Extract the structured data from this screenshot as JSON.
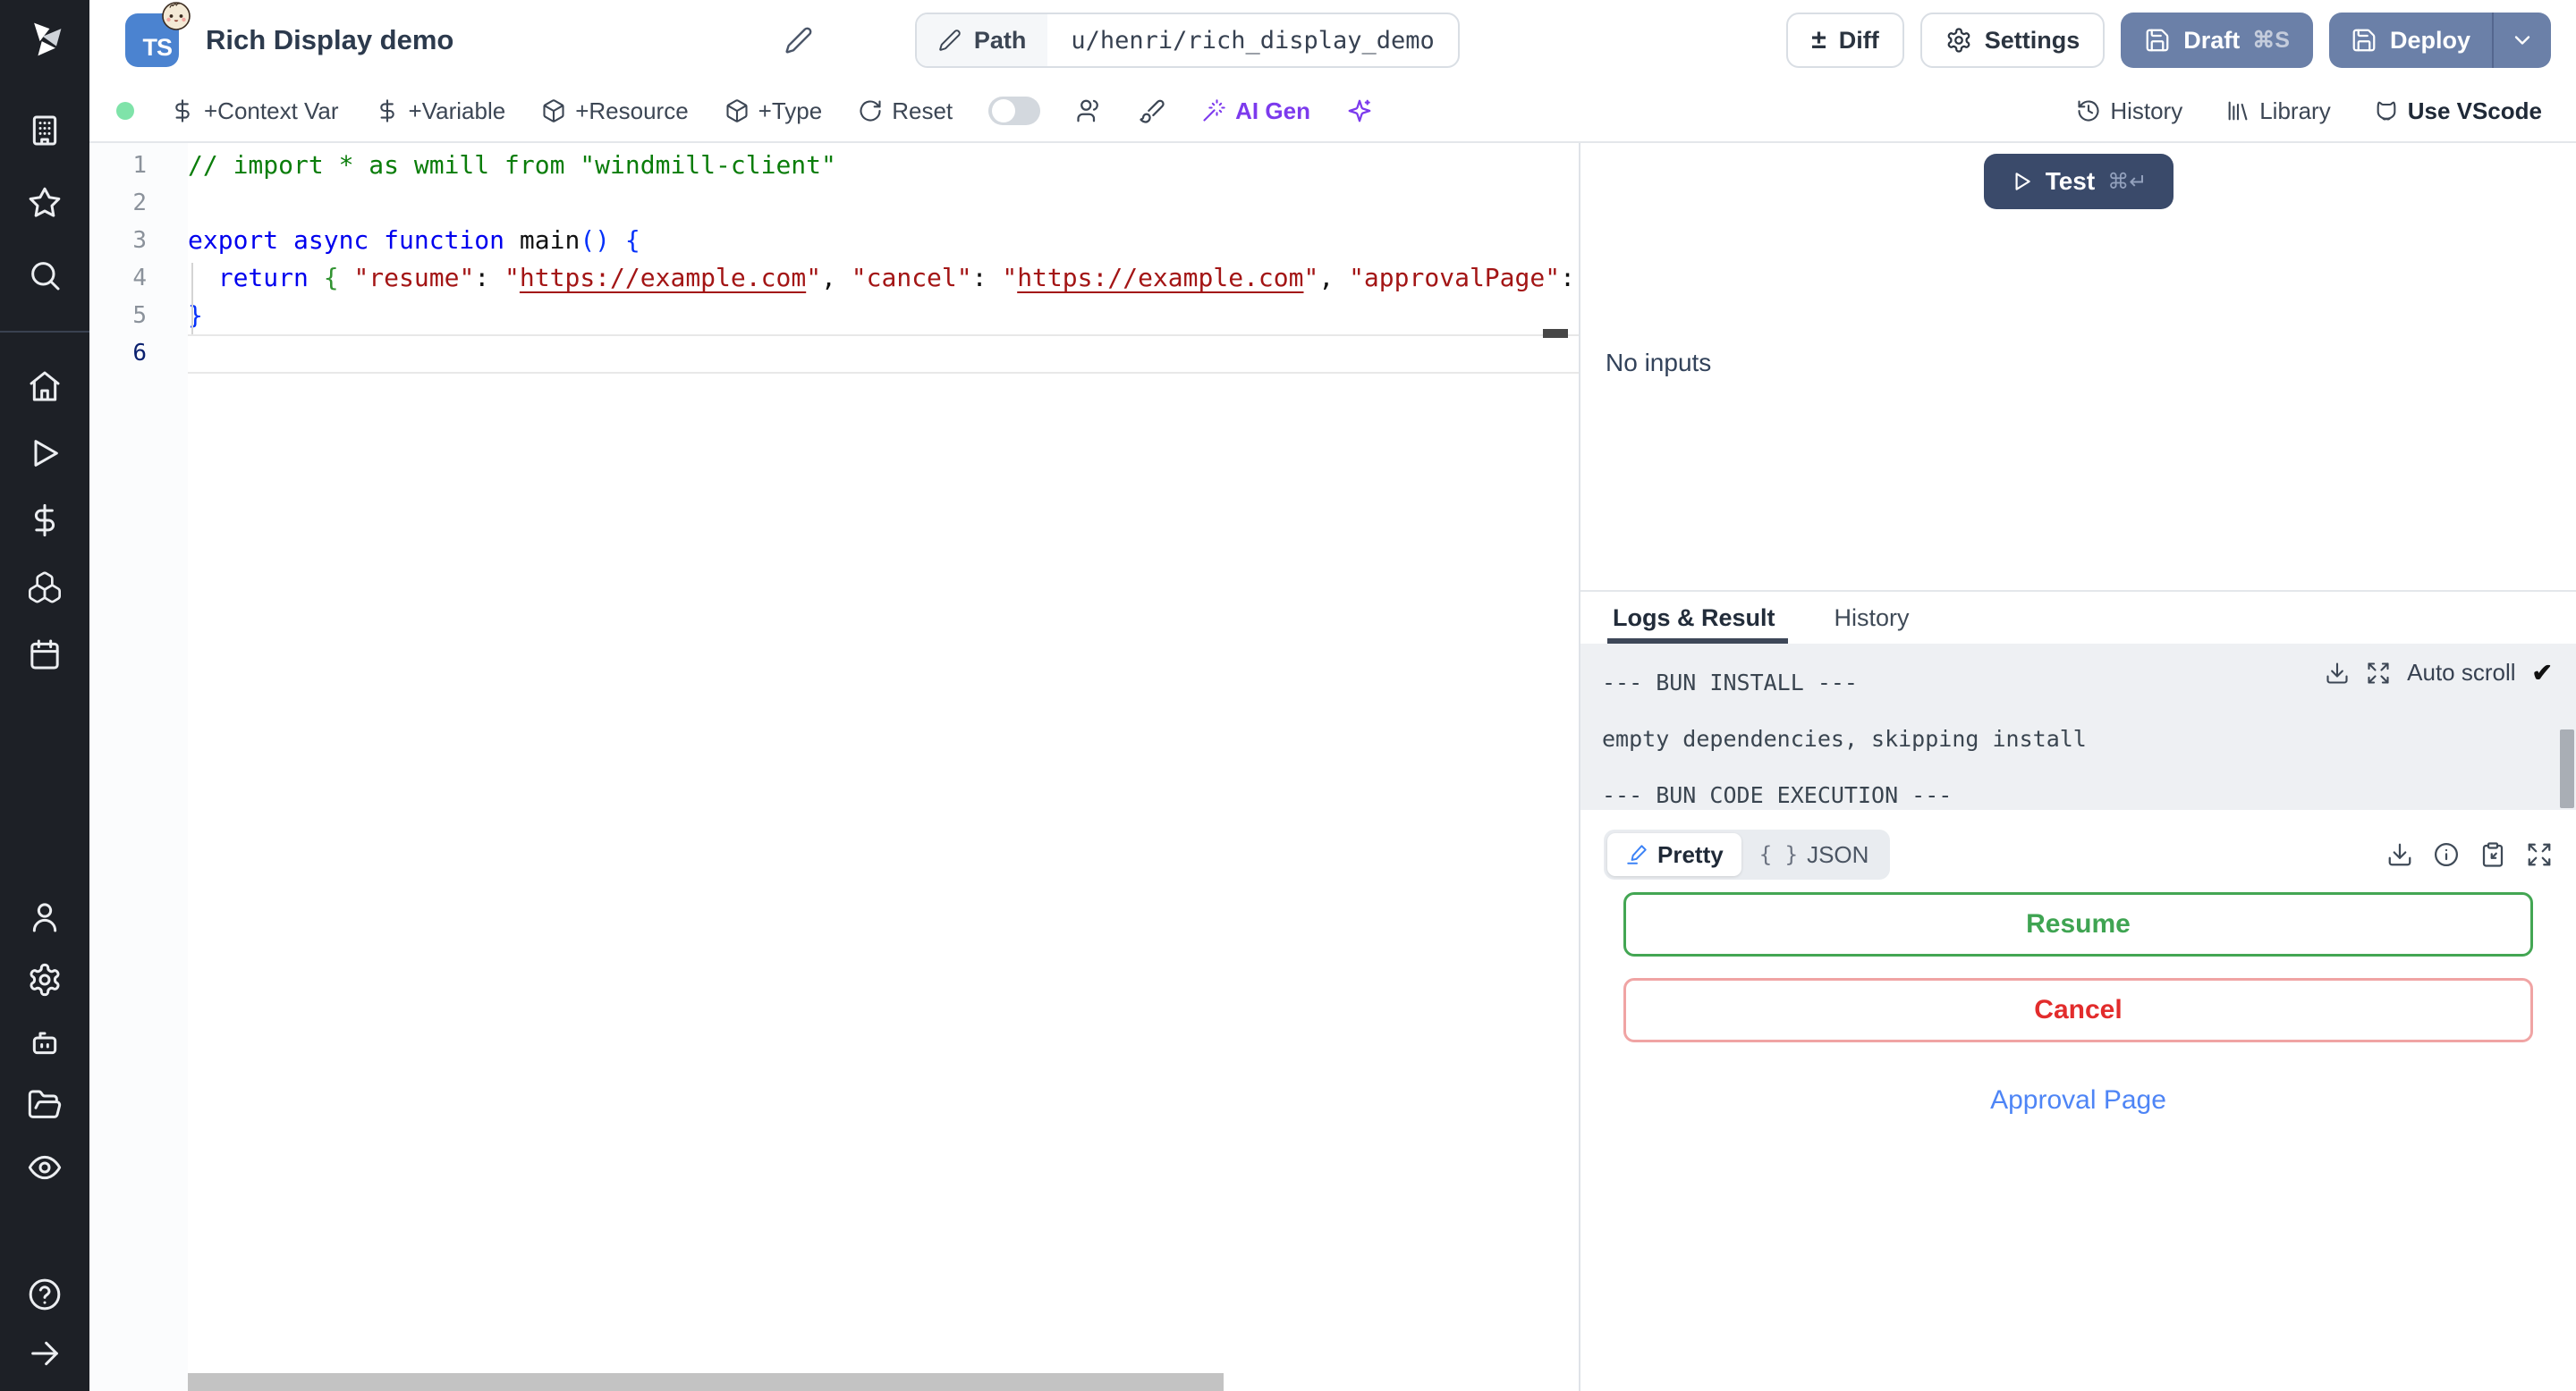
{
  "sidebar": {
    "icons": [
      "windmill-logo",
      "building",
      "star",
      "search",
      "home",
      "play",
      "dollar",
      "boxes",
      "calendar",
      "user",
      "settings",
      "bot",
      "folder-open",
      "eye",
      "help",
      "arrow-right"
    ]
  },
  "header": {
    "title": "Rich Display demo",
    "badge": "TS",
    "path_label": "Path",
    "path_value": "u/henri/rich_display_demo",
    "diff_label": "Diff",
    "settings_label": "Settings",
    "draft_label": "Draft",
    "draft_shortcut": "⌘S",
    "deploy_label": "Deploy"
  },
  "toolbar": {
    "context_var": "+Context Var",
    "variable": "+Variable",
    "resource": "+Resource",
    "type": "+Type",
    "reset": "Reset",
    "ai_gen": "AI Gen",
    "history": "History",
    "library": "Library",
    "vscode": "Use VScode"
  },
  "editor": {
    "line_numbers": [
      "1",
      "2",
      "3",
      "4",
      "5",
      "6"
    ],
    "lines": [
      {
        "tokens": [
          {
            "c": "cm",
            "t": "// import * as wmill from \"windmill-client\""
          }
        ]
      },
      {
        "tokens": []
      },
      {
        "tokens": [
          {
            "c": "kw",
            "t": "export async function "
          },
          {
            "c": "fn",
            "t": "main"
          },
          {
            "c": "brb",
            "t": "() {"
          }
        ]
      },
      {
        "tokens": [
          {
            "c": "pln",
            "t": "  "
          },
          {
            "c": "kw",
            "t": "return "
          },
          {
            "c": "brg",
            "t": "{ "
          },
          {
            "c": "str",
            "t": "\"resume\""
          },
          {
            "c": "pln",
            "t": ": "
          },
          {
            "c": "str",
            "t": "\""
          },
          {
            "c": "lnk",
            "t": "https://example.com"
          },
          {
            "c": "str",
            "t": "\""
          },
          {
            "c": "pln",
            "t": ", "
          },
          {
            "c": "str",
            "t": "\"cancel\""
          },
          {
            "c": "pln",
            "t": ": "
          },
          {
            "c": "str",
            "t": "\""
          },
          {
            "c": "lnk",
            "t": "https://example.com"
          },
          {
            "c": "str",
            "t": "\""
          },
          {
            "c": "pln",
            "t": ", "
          },
          {
            "c": "str",
            "t": "\"approvalPage\""
          },
          {
            "c": "pln",
            "t": ": "
          }
        ]
      },
      {
        "tokens": [
          {
            "c": "brb",
            "t": "}"
          }
        ]
      },
      {
        "tokens": []
      }
    ]
  },
  "run_panel": {
    "test_label": "Test",
    "test_shortcut": "⌘↵",
    "no_inputs": "No inputs"
  },
  "bottom_panel": {
    "tabs": [
      "Logs & Result",
      "History"
    ],
    "active_tab": "Logs & Result",
    "logs": [
      "--- BUN INSTALL ---",
      "empty dependencies, skipping install",
      "--- BUN CODE EXECUTION ---"
    ],
    "auto_scroll_label": "Auto scroll",
    "auto_scroll_checked": "✔"
  },
  "result": {
    "view_pretty": "Pretty",
    "view_json": "JSON",
    "json_glyph": "{ }",
    "resume_label": "Resume",
    "cancel_label": "Cancel",
    "approval_label": "Approval Page"
  },
  "colors": {
    "sidebar_bg": "#1d2026",
    "accent_slate_button": "#6b80a8",
    "test_button": "#3a4a6a",
    "ai_purple": "#7c3aed",
    "resume_green": "#43a653",
    "cancel_red": "#e22c2c",
    "link_blue": "#4e85f6",
    "ts_badge_blue": "#4b83d0",
    "status_dot_green": "#7fe3a9"
  }
}
